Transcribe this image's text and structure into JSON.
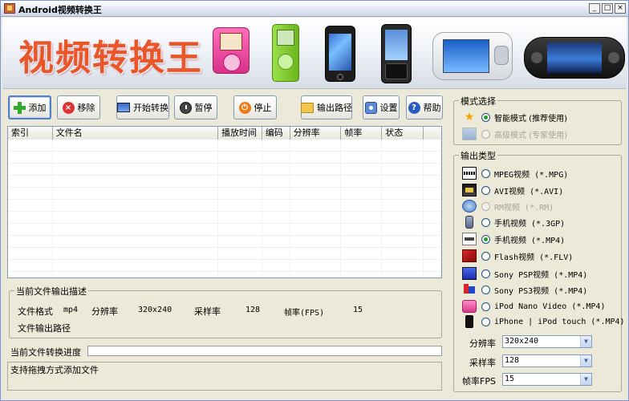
{
  "window": {
    "title": "Android视频转换王"
  },
  "banner": {
    "title": "视频转换王"
  },
  "toolbar": {
    "add": "添加",
    "remove": "移除",
    "start": "开始转换",
    "pause": "暂停",
    "stop": "停止",
    "output_path": "输出路径",
    "settings": "设置",
    "help": "帮助"
  },
  "file_table": {
    "columns": [
      "索引",
      "文件名",
      "播放时间",
      "编码",
      "分辨率",
      "帧率",
      "状态"
    ]
  },
  "description": {
    "title": "当前文件输出描述",
    "format_label": "文件格式",
    "format_value": "mp4",
    "resolution_label": "分辨率",
    "resolution_value": "320x240",
    "samplerate_label": "采样率",
    "samplerate_value": "128",
    "fps_label": "帧率(FPS)",
    "fps_value": "15",
    "path_label": "文件输出路径"
  },
  "progress": {
    "label": "当前文件转换进度",
    "value": 0
  },
  "status": {
    "text": "支持拖拽方式添加文件"
  },
  "mode": {
    "title": "模式选择",
    "smart": "智能模式 (推荐使用)",
    "expert": "高级模式 (专家使用)"
  },
  "output_type": {
    "title": "输出类型",
    "options": [
      "MPEG视频 (*.MPG)",
      "AVI视频 (*.AVI)",
      "RM视频 (*.RM)",
      "手机视频 (*.3GP)",
      "手机视频 (*.MP4)",
      "Flash视频 (*.FLV)",
      "Sony PSP视频 (*.MP4)",
      "Sony PS3视频 (*.MP4)",
      "iPod Nano Video (*.MP4)",
      "iPhone | iPod touch (*.MP4)"
    ],
    "selected_index": 4,
    "disabled_index": 2
  },
  "params": {
    "resolution_label": "分辨率",
    "resolution_value": "320x240",
    "samplerate_label": "采样率",
    "samplerate_value": "128",
    "fps_label": "帧率FPS",
    "fps_value": "15"
  }
}
